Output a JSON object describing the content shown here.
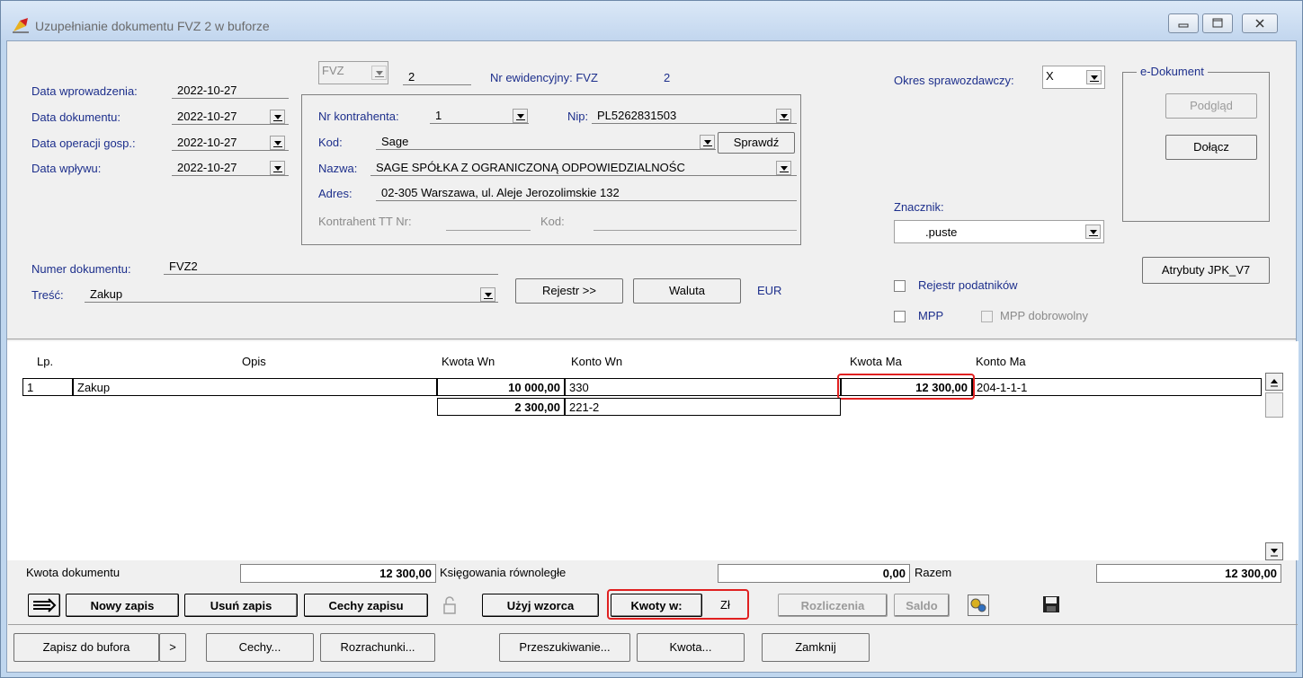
{
  "window": {
    "title": "Uzupełnianie dokumentu FVZ 2 w buforze"
  },
  "header": {
    "data_wprowadzenia_label": "Data wprowadzenia:",
    "data_wprowadzenia_value": "2022-10-27",
    "data_dokumentu_label": "Data dokumentu:",
    "data_dokumentu_value": "2022-10-27",
    "data_operacji_label": "Data operacji gosp.:",
    "data_operacji_value": "2022-10-27",
    "data_wplywu_label": "Data wpływu:",
    "data_wplywu_value": "2022-10-27",
    "doc_type": "FVZ",
    "doc_number": "2",
    "nr_ewid_label": "Nr ewidencyjny: FVZ",
    "nr_ewid_value": "2",
    "okres_label": "Okres sprawozdawczy:",
    "okres_value": "X"
  },
  "contractor": {
    "nr_label": "Nr kontrahenta:",
    "nr_value": "1",
    "nip_label": "Nip:",
    "nip_value": "PL5262831503",
    "kod_label": "Kod:",
    "kod_value": "Sage",
    "sprawdz_label": "Sprawdź",
    "nazwa_label": "Nazwa:",
    "nazwa_value": "SAGE SPÓŁKA Z OGRANICZONĄ ODPOWIEDZIALNOŚC",
    "adres_label": "Adres:",
    "adres_value": "02-305 Warszawa, ul. Aleje Jerozolimskie 132",
    "tt_label": "Kontrahent TT Nr:",
    "tt_kod_label": "Kod:"
  },
  "edokument": {
    "group_label": "e-Dokument",
    "podglad_label": "Podgląd",
    "dolacz_label": "Dołącz"
  },
  "znacznik": {
    "label": "Znacznik:",
    "value": ".puste"
  },
  "document": {
    "numer_label": "Numer dokumentu:",
    "numer_value": "FVZ2",
    "tresc_label": "Treść:",
    "tresc_value": "Zakup",
    "rejestr_label": "Rejestr >>",
    "waluta_label": "Waluta",
    "currency": "EUR",
    "jpk_label": "Atrybuty JPK_V7",
    "rejestr_podatnikow_label": "Rejestr podatników",
    "mpp_label": "MPP",
    "mpp_dobrowolny_label": "MPP dobrowolny"
  },
  "grid": {
    "headers": {
      "lp": "Lp.",
      "opis": "Opis",
      "kwota_wn": "Kwota Wn",
      "konto_wn": "Konto Wn",
      "kwota_ma": "Kwota Ma",
      "konto_ma": "Konto Ma"
    },
    "rows": [
      {
        "lp": "1",
        "opis": "Zakup",
        "kwota_wn": "10 000,00",
        "konto_wn": "330",
        "kwota_ma": "12 300,00",
        "konto_ma": "204-1-1-1"
      },
      {
        "lp": "",
        "opis": "",
        "kwota_wn": "2 300,00",
        "konto_wn": "221-2",
        "kwota_ma": "",
        "konto_ma": ""
      }
    ]
  },
  "summary": {
    "kwota_dokumentu_label": "Kwota dokumentu",
    "kwota_dokumentu_value": "12 300,00",
    "ksiegowania_label": "Księgowania równoległe",
    "ksiegowania_value": "0,00",
    "razem_label": "Razem",
    "razem_value": "12 300,00"
  },
  "toolbar": {
    "nowy_zapis": "Nowy zapis",
    "usun_zapis": "Usuń zapis",
    "cechy_zapisu": "Cechy zapisu",
    "uzyj_wzorca": "Użyj wzorca",
    "kwoty_w": "Kwoty w:",
    "kwoty_currency": "Zł",
    "rozliczenia": "Rozliczenia",
    "saldo": "Saldo"
  },
  "bottom": {
    "zapisz": "Zapisz do bufora",
    "more": ">",
    "cechy": "Cechy...",
    "rozrachunki": "Rozrachunki...",
    "przeszukiwanie": "Przeszukiwanie...",
    "kwota": "Kwota...",
    "zamknij": "Zamknij"
  }
}
